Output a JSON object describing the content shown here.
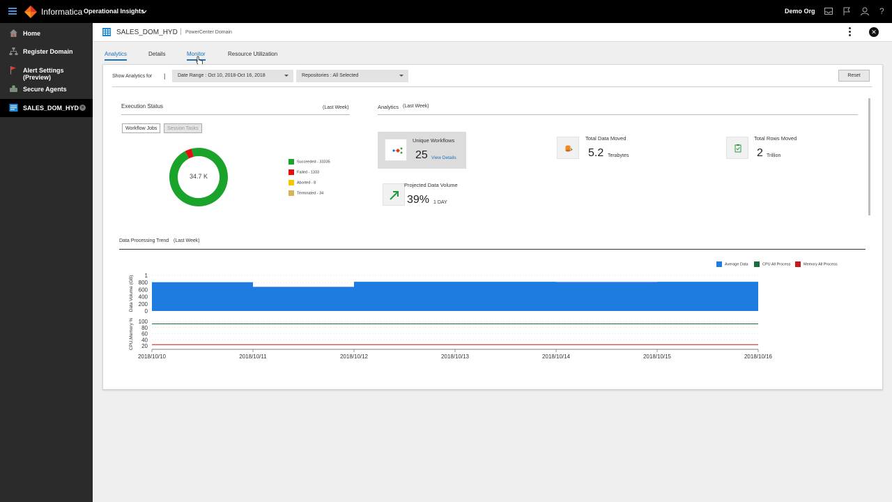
{
  "topbar": {
    "brand": "Informatica",
    "product": "Operational Insights",
    "org": "Demo Org",
    "icons": [
      "inbox-icon",
      "flag-icon",
      "user-icon",
      "help-icon"
    ],
    "help_glyph": "?"
  },
  "sidebar": {
    "items": [
      {
        "label": "Home",
        "icon": "home-icon"
      },
      {
        "label": "Register Domain",
        "icon": "network-icon"
      },
      {
        "label": "Alert Settings (Preview)",
        "icon": "flag-icon"
      },
      {
        "label": "Secure Agents",
        "icon": "agent-icon"
      },
      {
        "label": "SALES_DOM_HYD",
        "icon": "domain-icon",
        "active": true
      }
    ]
  },
  "header": {
    "domain_name": "SALES_DOM_HYD",
    "separator": "|",
    "domain_type": "PowerCenter Domain"
  },
  "tabs": [
    {
      "label": "Analytics",
      "active": true
    },
    {
      "label": "Details"
    },
    {
      "label": "Monitor",
      "hover": true
    },
    {
      "label": "Resource Utilization"
    }
  ],
  "filters": {
    "show_label": "Show Analytics for",
    "separator": "|",
    "date_range": "Date Range : Oct 10, 2018-Oct 16, 2018",
    "repositories": "Repositories : All Selected",
    "reset": "Reset"
  },
  "execution_status": {
    "title": "Execution Status",
    "period": "(Last Week)",
    "toggle_workflow": "Workflow Jobs",
    "toggle_session": "Session Tasks",
    "donut_center": "34.7 K",
    "legend": [
      {
        "label": "Succeeded - 33335",
        "value": 33335,
        "color": "#1aa32b"
      },
      {
        "label": "Failed - 1333",
        "value": 1333,
        "color": "#e01010"
      },
      {
        "label": "Aborted - 8",
        "value": 8,
        "color": "#f2c500"
      },
      {
        "label": "Terminated - 34",
        "value": 34,
        "color": "#d8b25a"
      }
    ]
  },
  "analytics": {
    "title": "Analytics",
    "period": "(Last Week)",
    "unique_workflows": {
      "title": "Unique Workflows",
      "value": "25",
      "link": "View Details"
    },
    "total_data_moved": {
      "title": "Total Data Moved",
      "value": "5.2",
      "unit": "Terabytes"
    },
    "total_rows_moved": {
      "title": "Total Rows Moved",
      "value": "2",
      "unit": "Trillion"
    },
    "projected": {
      "title": "Projected Data Volume",
      "value": "39%",
      "unit": "1 DAY"
    }
  },
  "trend": {
    "title": "Data Processing Trend",
    "period": "(Last Week)"
  },
  "chart_data": {
    "type": "area",
    "title": "Data Processing Trend (Last Week)",
    "legend": [
      {
        "name": "Average Data",
        "color": "#1e7be0"
      },
      {
        "name": "CPU All Process",
        "color": "#1a6e3c"
      },
      {
        "name": "Memory All Process",
        "color": "#c81818"
      }
    ],
    "x": [
      "2018/10/10",
      "2018/10/11",
      "2018/10/12",
      "2018/10/13",
      "2018/10/14",
      "2018/10/15",
      "2018/10/16"
    ],
    "top_panel": {
      "ylabel": "Data Volume (GB)",
      "yticks": [
        "1",
        "800",
        "600",
        "400",
        "200",
        "0"
      ],
      "series": [
        {
          "name": "Average Data",
          "values": [
            810,
            680,
            820,
            820,
            815,
            820,
            820
          ]
        }
      ]
    },
    "bottom_panel": {
      "ylabel": "CPU,Memory %",
      "yticks": [
        "100",
        "80",
        "60",
        "40",
        "20"
      ],
      "series": [
        {
          "name": "CPU All Process",
          "values": [
            92,
            92,
            92,
            92,
            92,
            92,
            92
          ]
        },
        {
          "name": "Memory All Process",
          "values": [
            24,
            24,
            24,
            24,
            24,
            24,
            24
          ]
        }
      ]
    }
  }
}
